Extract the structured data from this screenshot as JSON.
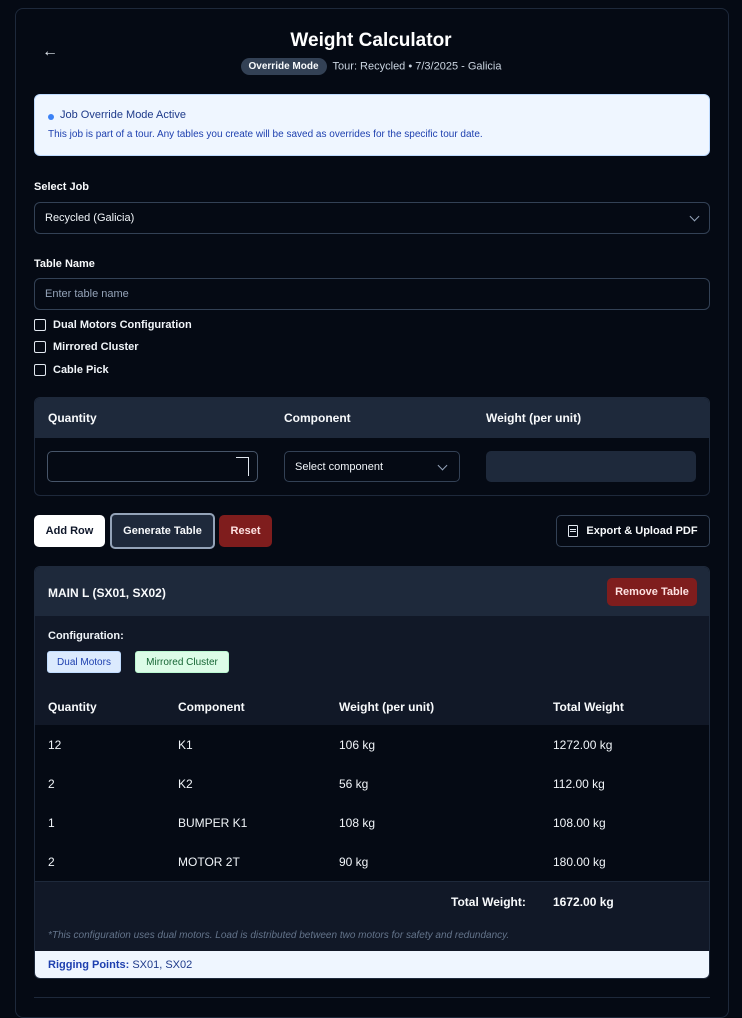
{
  "header": {
    "title": "Weight Calculator",
    "mode_badge": "Override Mode",
    "tour_info": "Tour: Recycled • 7/3/2025 - Galicia",
    "back_icon": "arrow-left-icon"
  },
  "alert": {
    "title": "Job Override Mode Active",
    "body": "This job is part of a tour. Any tables you create will be saved as overrides for the specific tour date."
  },
  "form": {
    "job_label": "Select Job",
    "job_value": "Recycled (Galicia)",
    "table_name_label": "Table Name",
    "table_name_placeholder": "Enter table name",
    "table_name_value": "",
    "checkboxes": [
      {
        "label": "Dual Motors Configuration",
        "checked": false
      },
      {
        "label": "Mirrored Cluster",
        "checked": false
      },
      {
        "label": "Cable Pick",
        "checked": false
      }
    ]
  },
  "builder": {
    "headers": [
      "Quantity",
      "Component",
      "Weight (per unit)"
    ],
    "quantity_value": "",
    "component_placeholder": "Select component",
    "weight_value": ""
  },
  "actions": {
    "add_row": "Add Row",
    "generate": "Generate Table",
    "reset": "Reset",
    "export": "Export & Upload PDF"
  },
  "result_table": {
    "title": "MAIN L (SX01, SX02)",
    "remove_label": "Remove Table",
    "config_label": "Configuration:",
    "tags": [
      "Dual Motors",
      "Mirrored Cluster"
    ],
    "headers": [
      "Quantity",
      "Component",
      "Weight (per unit)",
      "Total Weight"
    ],
    "rows": [
      {
        "quantity": "12",
        "component": "K1",
        "weight": "106 kg",
        "total": "1272.00 kg"
      },
      {
        "quantity": "2",
        "component": "K2",
        "weight": "56 kg",
        "total": "112.00 kg"
      },
      {
        "quantity": "1",
        "component": "BUMPER K1",
        "weight": "108 kg",
        "total": "108.00 kg"
      },
      {
        "quantity": "2",
        "component": "MOTOR 2T",
        "weight": "90 kg",
        "total": "180.00 kg"
      }
    ],
    "total_label": "Total Weight:",
    "total_value": "1672.00 kg",
    "note": "*This configuration uses dual motors. Load is distributed between two motors for safety and redundancy.",
    "rigging_label": "Rigging Points:",
    "rigging_value": "SX01, SX02"
  },
  "colors": {
    "background": "#050a14",
    "panel": "#1e293b",
    "danger": "#7f1d1d",
    "info_bg": "#eff6ff",
    "accent": "#3b82f6"
  }
}
